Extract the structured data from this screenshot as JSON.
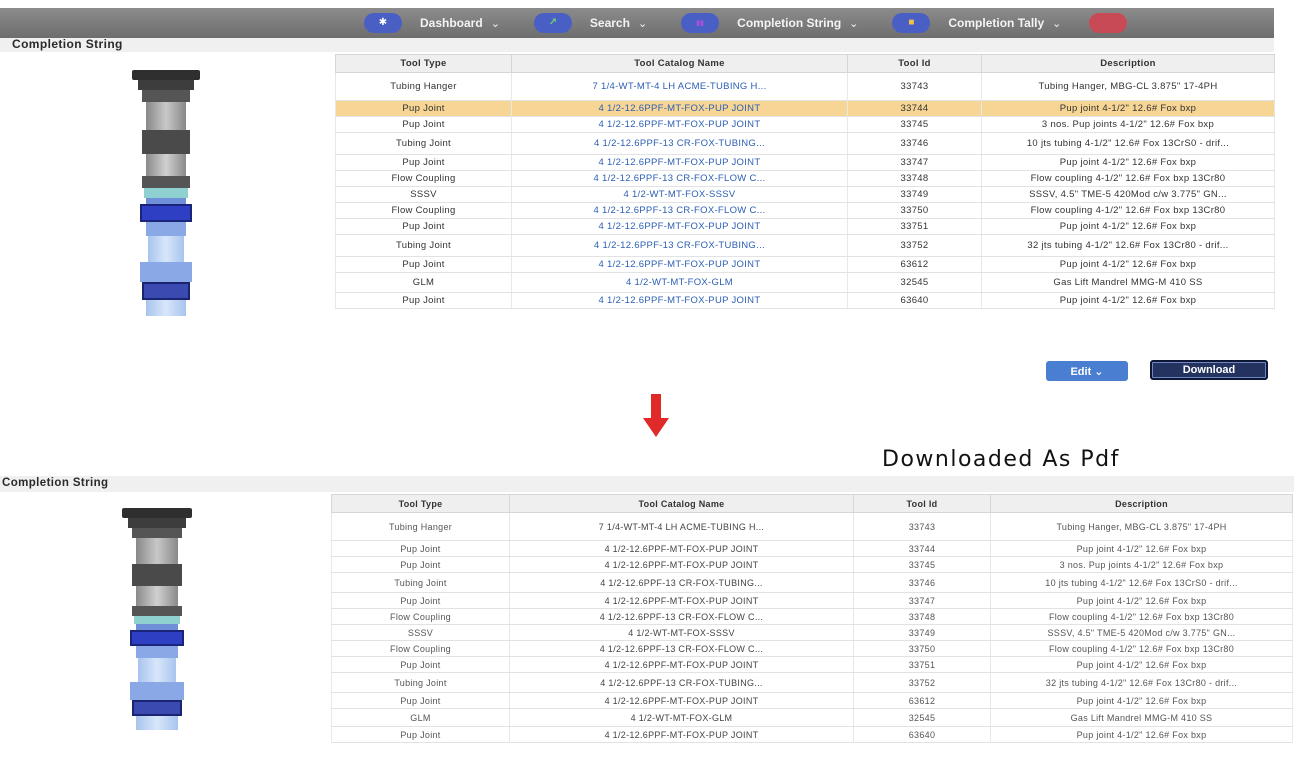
{
  "nav": {
    "items": [
      {
        "label": "Dashboard",
        "icon": "star-icon",
        "glyph": "✱",
        "glyph_color": "#ffffff"
      },
      {
        "label": "Search",
        "icon": "chart-icon",
        "glyph": "↗",
        "glyph_color": "#6fd16f"
      },
      {
        "label": "Completion String",
        "icon": "bars-icon",
        "glyph": "▮▮",
        "glyph_color": "#b04fd8"
      },
      {
        "label": "Completion Tally",
        "icon": "folder-icon",
        "glyph": "■",
        "glyph_color": "#f0c24a"
      }
    ],
    "chevron": "⌄"
  },
  "section_title": "Completion String",
  "columns": [
    "Tool Type",
    "Tool Catalog Name",
    "Tool Id",
    "Description"
  ],
  "rows": [
    [
      "Tubing Hanger",
      "7 1/4-WT-MT-4 LH ACME-TUBING H...",
      "33743",
      "Tubing Hanger, MBG-CL 3.875\" 17-4PH"
    ],
    [
      "Pup Joint",
      "4 1/2-12.6PPF-MT-FOX-PUP JOINT",
      "33744",
      "Pup joint 4-1/2\" 12.6# Fox bxp"
    ],
    [
      "Pup Joint",
      "4 1/2-12.6PPF-MT-FOX-PUP JOINT",
      "33745",
      "3 nos. Pup joints 4-1/2\" 12.6# Fox bxp"
    ],
    [
      "Tubing Joint",
      "4 1/2-12.6PPF-13 CR-FOX-TUBING...",
      "33746",
      "10 jts tubing 4-1/2\" 12.6# Fox 13CrS0 - drif..."
    ],
    [
      "Pup Joint",
      "4 1/2-12.6PPF-MT-FOX-PUP JOINT",
      "33747",
      "Pup joint 4-1/2\" 12.6# Fox bxp"
    ],
    [
      "Flow Coupling",
      "4 1/2-12.6PPF-13 CR-FOX-FLOW C...",
      "33748",
      "Flow coupling 4-1/2\" 12.6# Fox bxp 13Cr80"
    ],
    [
      "SSSV",
      "4 1/2-WT-MT-FOX-SSSV",
      "33749",
      "SSSV, 4.5\" TME-5 420Mod c/w 3.775\" GN..."
    ],
    [
      "Flow Coupling",
      "4 1/2-12.6PPF-13 CR-FOX-FLOW C...",
      "33750",
      "Flow coupling 4-1/2\" 12.6# Fox bxp 13Cr80"
    ],
    [
      "Pup Joint",
      "4 1/2-12.6PPF-MT-FOX-PUP JOINT",
      "33751",
      "Pup joint 4-1/2\" 12.6# Fox bxp"
    ],
    [
      "Tubing Joint",
      "4 1/2-12.6PPF-13 CR-FOX-TUBING...",
      "33752",
      "32 jts tubing 4-1/2\" 12.6# Fox 13Cr80 - drif..."
    ],
    [
      "Pup Joint",
      "4 1/2-12.6PPF-MT-FOX-PUP JOINT",
      "63612",
      "Pup joint 4-1/2\" 12.6# Fox bxp"
    ],
    [
      "GLM",
      "4 1/2-WT-MT-FOX-GLM",
      "32545",
      "Gas Lift Mandrel MMG-M 410 SS"
    ],
    [
      "Pup Joint",
      "4 1/2-12.6PPF-MT-FOX-PUP JOINT",
      "63640",
      "Pup joint 4-1/2\" 12.6# Fox bxp"
    ]
  ],
  "selected_row": 1,
  "buttons": {
    "edit": "Edit ⌄",
    "download": "Download"
  },
  "arrow_color": "#e02a2a",
  "pdf_caption": "Downloaded As Pdf",
  "pdf_columns": [
    "Tool Type",
    "Tool Catalog Name",
    "Tool Id",
    "Description"
  ],
  "colors": {
    "navbar": "#7a7a7a",
    "nav_pill": "#4a5fc4",
    "link": "#2c5fb4",
    "selected_row": "#f6d595",
    "edit_button": "#4a7ed0",
    "download_button": "#23325f"
  }
}
